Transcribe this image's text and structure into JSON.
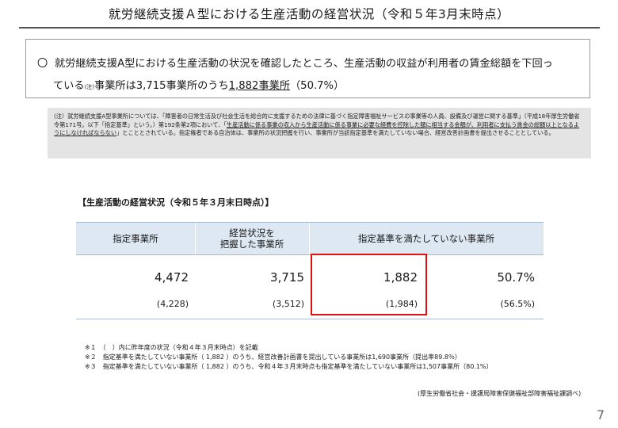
{
  "title": "就労継続支援Ａ型における生産活動の経営状況（令和５年3月末時点）",
  "summary": {
    "bullet": "〇",
    "line1": "就労継続支援A型における生産活動の状況を確認したところ、生産活動の収益が利用者の賃金総額を下回っ",
    "line2_pre": "ている",
    "line2_tiny": "(注)",
    "line2_mid": "事業所は3,715事業所のうち",
    "line2_ul": "1,882事業所",
    "line2_post": "（50.7%）"
  },
  "note": {
    "part1": "(注）就労継続支援A型事業所については、「障害者の日常生活及び社会生活を総合的に支援するための法律に基づく指定障害福祉サービスの事業等の人員、設備及び運営に関する基準」（平成18年厚生労働省令第171号。以下「指定基準」という。）第192条第2項において、「",
    "part2_ul": "生産活動に係る事業の収入から生産活動に係る事業に必要な経費を控除した額に相当する金額が、利用者に支払う賃金の総額以上となるようにしなければならない",
    "part3": "」とこととされている。指定権者である自治体は、事業所の状況把握を行い、事業所が当該指定基準を満たしていない場合、経営改善計画書を提出させることとしている。"
  },
  "table_title": "【生産活動の経営状況（令和５年３月末日時点）】",
  "table": {
    "headers": [
      "指定事業所",
      "経営状況を\n把握した事業所",
      "指定基準を満たしていない事業所"
    ],
    "values": [
      "4,472",
      "3,715",
      "1,882",
      "50.7%"
    ],
    "prev": [
      "(4,228)",
      "(3,512)",
      "(1,984)",
      "(56.5%)"
    ]
  },
  "footnotes": [
    "※１　（　）内に昨年度の状況（令和４年３月末時点）を記載",
    "※２　指定基準を満たしていない事業所（ 1,882 ）のうち、経営改善計画書を提出している事業所は1,690事業所（提出率89.8％）",
    "※３　指定基準を満たしていない事業所（ 1,882 ）のうち、令和４年３月末時点も指定基準を満たしていない事業所は1,507事業所（80.1%）"
  ],
  "source": "(厚生労働省社会・援護局障害保健福祉部障害福祉課調べ)",
  "page_number": "7"
}
